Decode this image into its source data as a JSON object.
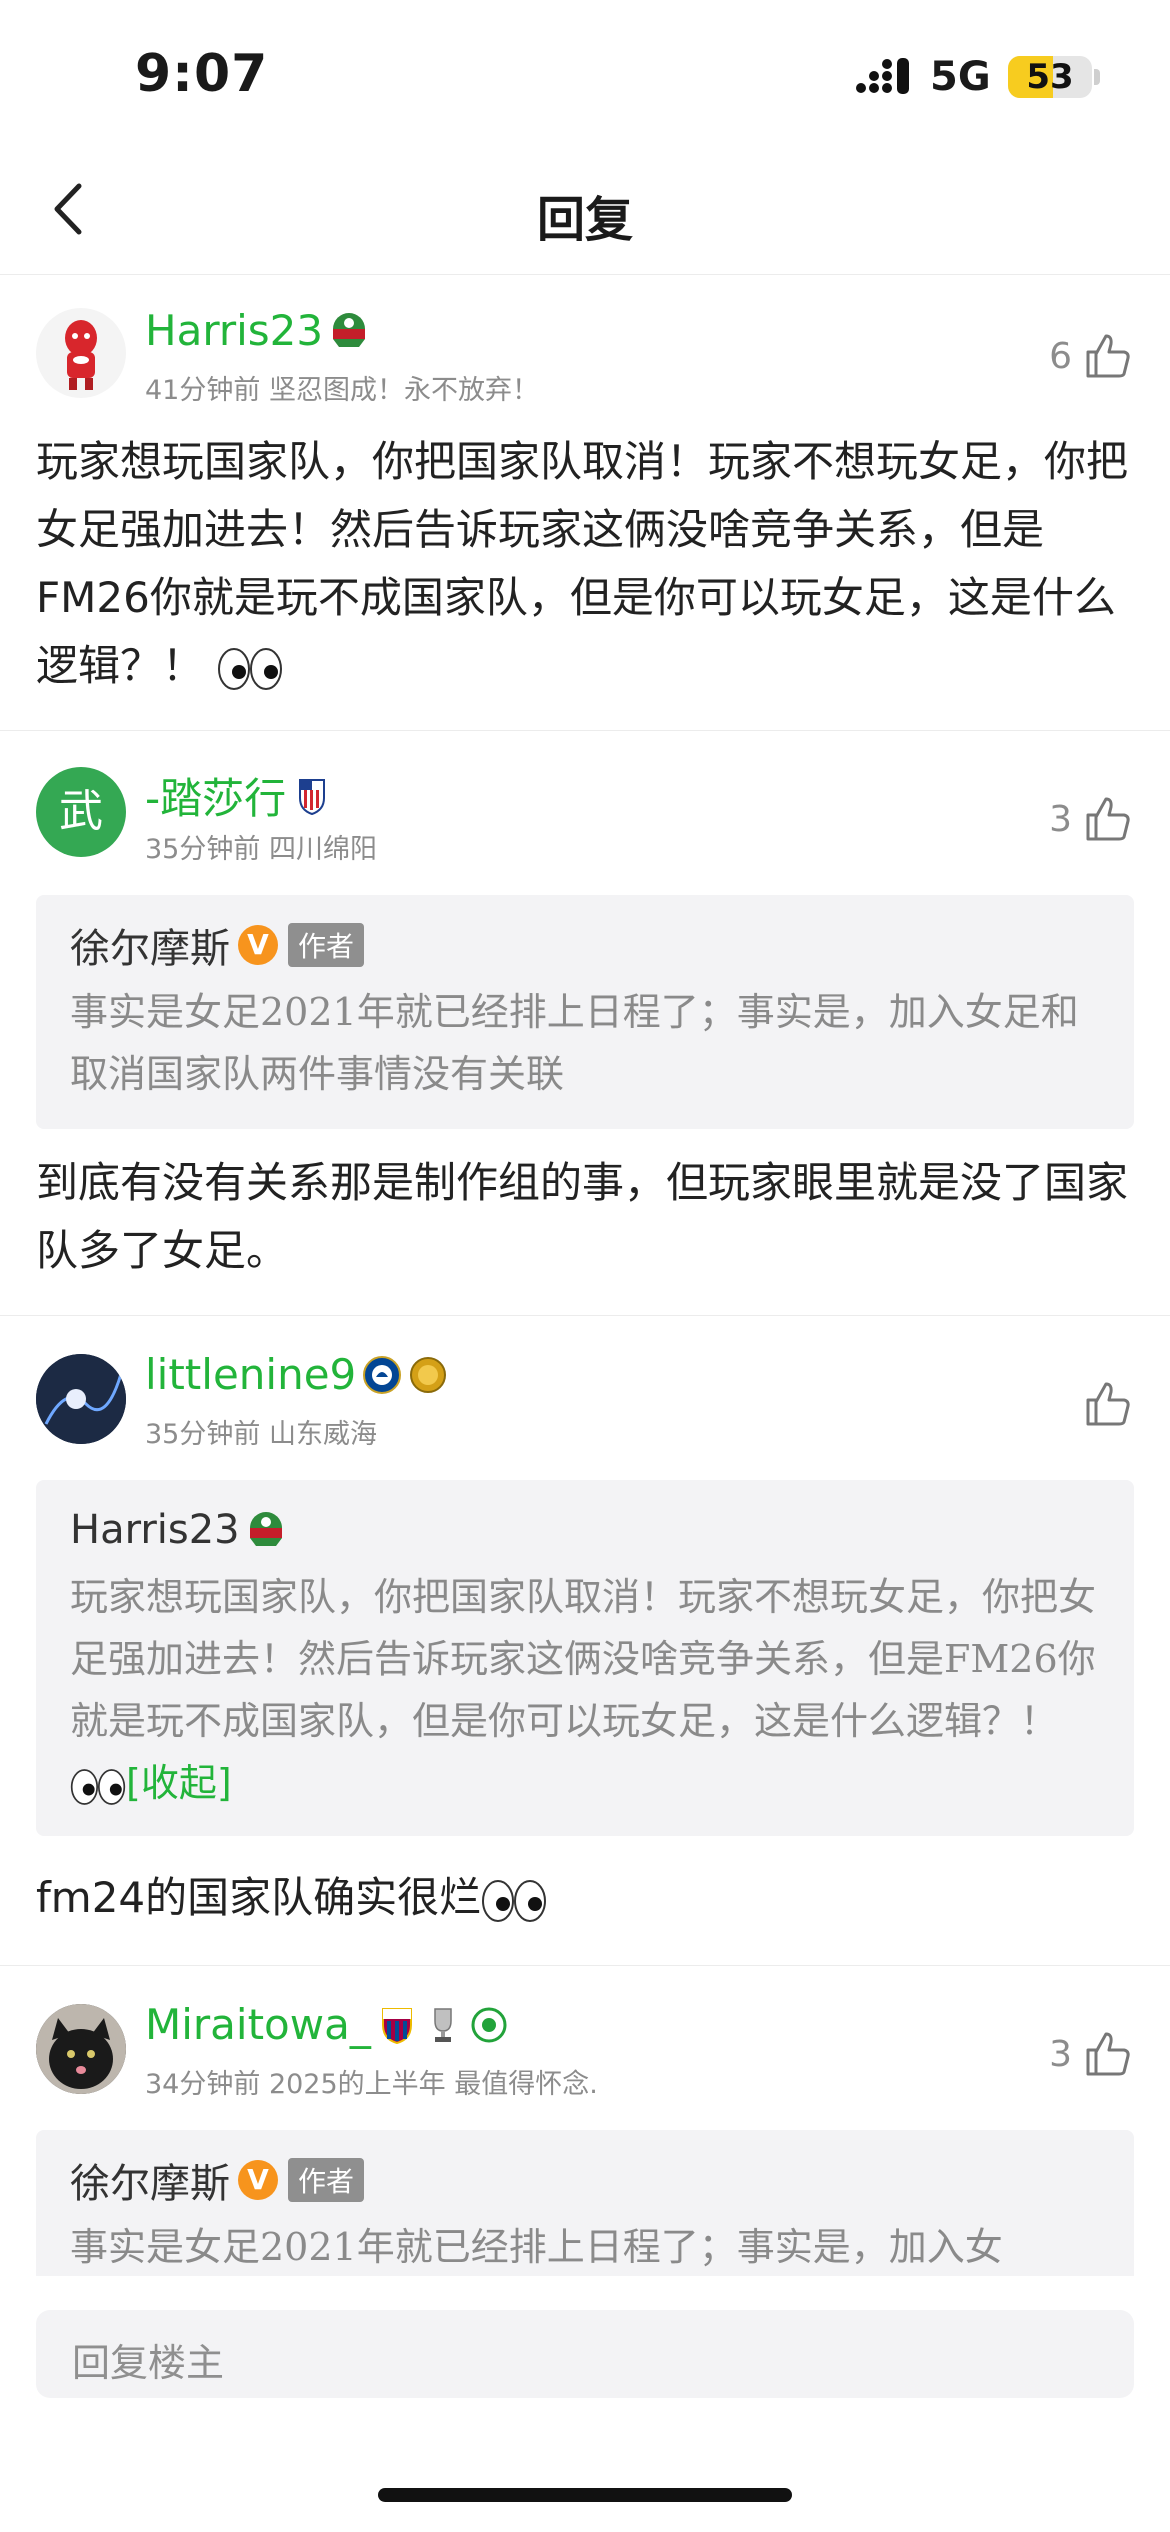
{
  "status_bar": {
    "time": "9:07",
    "network": "5G",
    "battery": "53",
    "battery_level": 0.53
  },
  "nav": {
    "title": "回复"
  },
  "comments": [
    {
      "username": "Harris23",
      "meta": "41分钟前 坚忍图成！永不放弃！",
      "likes": "6",
      "content": "玩家想玩国家队，你把国家队取消！玩家不想玩女足，你把女足强加进去！然后告诉玩家这俩没啥竞争关系，但是FM26你就是玩不成国家队，但是你可以玩女足，这是什么逻辑？！"
    },
    {
      "username": "-踏莎行",
      "avatar_text": "武",
      "meta": "35分钟前 四川绵阳",
      "likes": "3",
      "quote": {
        "username": "徐尔摩斯",
        "v_badge": "V",
        "author_tag": "作者",
        "text": "事实是女足2021年就已经排上日程了；事实是，加入女足和取消国家队两件事情没有关联"
      },
      "content": "到底有没有关系那是制作组的事，但玩家眼里就是没了国家队多了女足。"
    },
    {
      "username": "littlenine9",
      "meta": "35分钟前 山东威海",
      "likes": "",
      "quote": {
        "username": "Harris23",
        "text": "玩家想玩国家队，你把国家队取消！玩家不想玩女足，你把女足强加进去！然后告诉玩家这俩没啥竞争关系，但是FM26你就是玩不成国家队，但是你可以玩女足，这是什么逻辑？！",
        "collapse": "[收起]"
      },
      "content": "fm24的国家队确实很烂"
    },
    {
      "username": "Miraitowa_",
      "meta": "34分钟前 2025的上半年 最值得怀念.",
      "likes": "3",
      "quote": {
        "username": "徐尔摩斯",
        "v_badge": "V",
        "author_tag": "作者",
        "text": "事实是女足2021年就已经排上日程了；事实是，加入女"
      }
    }
  ],
  "reply_bar": {
    "placeholder": "回复楼主"
  },
  "colors": {
    "accent_green": "#22b43a",
    "meta_gray": "#8c8c8c",
    "quote_bg": "#f3f3f5",
    "v_orange": "#f7941d"
  }
}
